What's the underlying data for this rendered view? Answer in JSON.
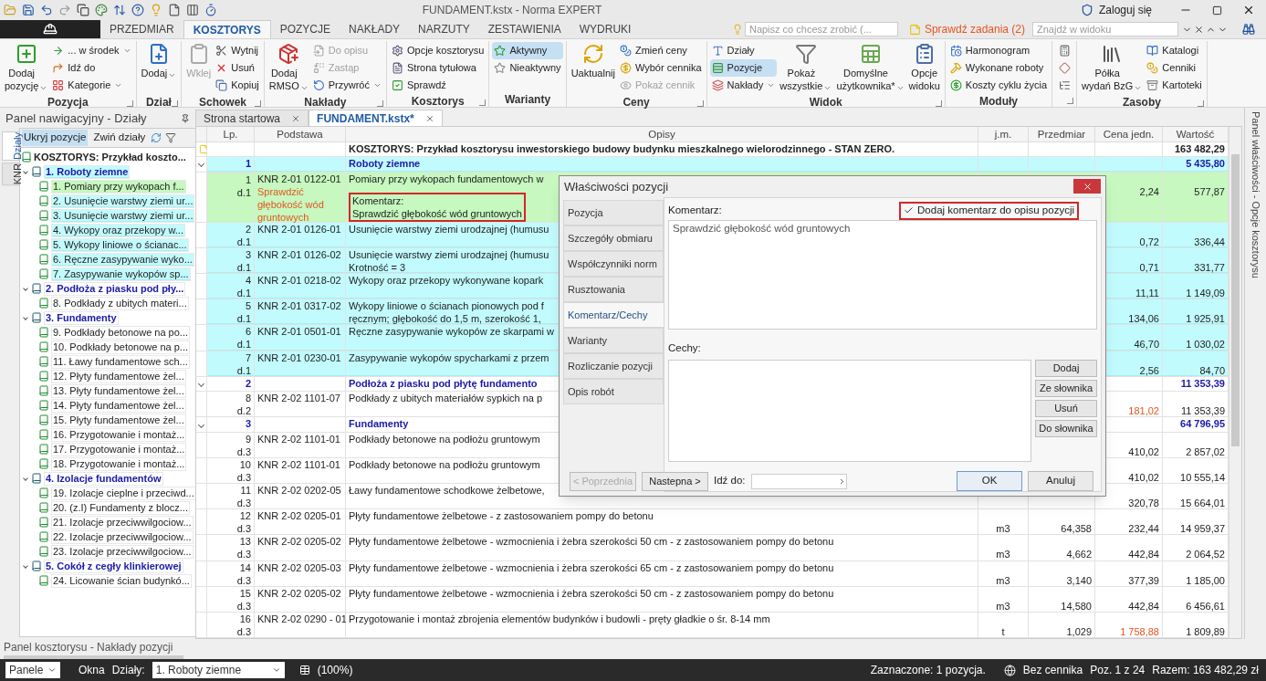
{
  "title_bar": {
    "title": "FUNDAMENT.kstx - Norma EXPERT",
    "login": "Zaloguj się"
  },
  "menu_tabs": [
    {
      "label": "PRZEDMIAR",
      "selected": false
    },
    {
      "label": "KOSZTORYS",
      "selected": true
    },
    {
      "label": "POZYCJE",
      "selected": false
    },
    {
      "label": "NAKŁADY",
      "selected": false
    },
    {
      "label": "NARZUTY",
      "selected": false
    },
    {
      "label": "ZESTAWIENIA",
      "selected": false
    },
    {
      "label": "WYDRUKI",
      "selected": false
    }
  ],
  "tell_me": {
    "placeholder": "Napisz co chcesz zrobić (..."
  },
  "tasks_link": "Sprawdź zadania (2)",
  "find": {
    "placeholder": "Znajdź w widoku"
  },
  "ribbon": [
    {
      "label": "Pozycja",
      "launcher": true,
      "items": [
        {
          "kind": "large",
          "label": "Dodaj\npozycję",
          "dropdown": true,
          "disabled": false,
          "selected": false
        },
        {
          "kind": "small",
          "label": "... w środek",
          "dropdown": true,
          "disabled": false,
          "selected": false
        },
        {
          "kind": "small",
          "label": "Idź do",
          "dropdown": false,
          "disabled": false,
          "selected": false
        },
        {
          "kind": "small",
          "label": "Kategorie",
          "dropdown": true,
          "disabled": false,
          "selected": false
        }
      ]
    },
    {
      "label": "Dział",
      "launcher": true,
      "items": [
        {
          "kind": "large",
          "label": "Dodaj",
          "dropdown": true,
          "disabled": false,
          "selected": false
        }
      ]
    },
    {
      "label": "Schowek",
      "launcher": true,
      "items": [
        {
          "kind": "large",
          "label": "Wklej",
          "dropdown": false,
          "disabled": true,
          "selected": false
        },
        {
          "kind": "small",
          "label": "Wytnij",
          "dropdown": false,
          "disabled": false,
          "selected": false
        },
        {
          "kind": "small",
          "label": "Usuń",
          "dropdown": false,
          "disabled": false,
          "selected": false
        },
        {
          "kind": "small",
          "label": "Kopiuj",
          "dropdown": false,
          "disabled": false,
          "selected": false
        }
      ]
    },
    {
      "label": "Nakłady",
      "launcher": true,
      "items": [
        {
          "kind": "large",
          "label": "Dodaj\nRMSO",
          "dropdown": true,
          "disabled": false,
          "selected": false
        },
        {
          "kind": "small",
          "label": "Do opisu",
          "dropdown": false,
          "disabled": true,
          "selected": false
        },
        {
          "kind": "small",
          "label": "Zastąp",
          "dropdown": false,
          "disabled": true,
          "selected": false
        },
        {
          "kind": "small",
          "label": "Przywróć",
          "dropdown": true,
          "disabled": false,
          "selected": false
        }
      ]
    },
    {
      "label": "Kosztorys",
      "launcher": true,
      "items": [
        {
          "kind": "small",
          "label": "Opcje kosztorysu",
          "dropdown": false,
          "disabled": false,
          "selected": false
        },
        {
          "kind": "small",
          "label": "Strona tytułowa",
          "dropdown": false,
          "disabled": false,
          "selected": false
        },
        {
          "kind": "small",
          "label": "Sprawdź",
          "dropdown": false,
          "disabled": false,
          "selected": false
        }
      ]
    },
    {
      "label": "Warianty",
      "launcher": false,
      "items": [
        {
          "kind": "small",
          "label": "Aktywny",
          "dropdown": false,
          "disabled": false,
          "selected": true
        },
        {
          "kind": "small",
          "label": "Nieaktywny",
          "dropdown": false,
          "disabled": false,
          "selected": false
        }
      ]
    },
    {
      "label": "Ceny",
      "launcher": true,
      "items": [
        {
          "kind": "large",
          "label": "Uaktualnij",
          "dropdown": false,
          "disabled": false,
          "selected": false
        },
        {
          "kind": "small",
          "label": "Zmień ceny",
          "dropdown": false,
          "disabled": false,
          "selected": false
        },
        {
          "kind": "small",
          "label": "Wybór cennika",
          "dropdown": false,
          "disabled": false,
          "selected": false
        },
        {
          "kind": "small",
          "label": "Pokaż cennik",
          "dropdown": false,
          "disabled": true,
          "selected": false
        }
      ]
    },
    {
      "label": "Widok",
      "launcher": true,
      "items": [
        {
          "kind": "small",
          "label": "Działy",
          "dropdown": false,
          "disabled": false,
          "selected": false
        },
        {
          "kind": "small",
          "label": "Pozycje",
          "dropdown": false,
          "disabled": false,
          "selected": true
        },
        {
          "kind": "small",
          "label": "Nakłady",
          "dropdown": true,
          "disabled": false,
          "selected": false
        },
        {
          "kind": "large",
          "label": "Pokaż\nwszystkie",
          "dropdown": true,
          "disabled": false,
          "selected": false
        },
        {
          "kind": "large",
          "label": "Domyślne\nużytkownika*",
          "dropdown": true,
          "disabled": false,
          "selected": false
        },
        {
          "kind": "large",
          "label": "Opcje\nwidoku",
          "dropdown": false,
          "disabled": false,
          "selected": false
        }
      ]
    },
    {
      "label": "Moduły",
      "launcher": false,
      "items": [
        {
          "kind": "small",
          "label": "Harmonogram",
          "dropdown": false,
          "disabled": false,
          "selected": false
        },
        {
          "kind": "small",
          "label": "Wykonane roboty",
          "dropdown": false,
          "disabled": false,
          "selected": false
        },
        {
          "kind": "small",
          "label": "Koszty cyklu życia",
          "dropdown": false,
          "disabled": false,
          "selected": false
        }
      ]
    },
    {
      "launcher": true,
      "items": [
        {
          "kind": "icon",
          "dropdown": false,
          "disabled": false,
          "selected": false
        },
        {
          "kind": "icon",
          "dropdown": false,
          "disabled": false,
          "selected": false
        },
        {
          "kind": "icon",
          "dropdown": false,
          "disabled": false,
          "selected": false
        }
      ]
    },
    {
      "label": "Zasoby",
      "launcher": true,
      "items": [
        {
          "kind": "large",
          "label": "Półka\nwydań BzG",
          "dropdown": true,
          "disabled": false,
          "selected": false
        },
        {
          "kind": "small",
          "label": "Katalogi",
          "dropdown": false,
          "disabled": false,
          "selected": false
        },
        {
          "kind": "small",
          "label": "Cenniki",
          "dropdown": false,
          "disabled": false,
          "selected": false
        },
        {
          "kind": "small",
          "label": "Kartoteki",
          "dropdown": false,
          "disabled": false,
          "selected": false
        }
      ]
    }
  ],
  "navigator": {
    "title": "Panel nawigacyjny - Działy",
    "side_tabs": [
      {
        "label": "Działy",
        "selected": true
      },
      {
        "label": "KNR",
        "selected": false
      }
    ],
    "tools": [
      {
        "label": "Ukryj pozycje",
        "selected": true
      },
      {
        "label": "Zwiń działy",
        "selected": false
      }
    ],
    "tree": {
      "label": "KOSZTORYS: Przykład koszto...",
      "children": [
        {
          "label": "1. Roboty ziemne",
          "expanded": true,
          "selected": false,
          "highlighted": true,
          "children": [
            {
              "label": "1. Pomiary przy wykopach f...",
              "selected": true,
              "highlighted": false
            },
            {
              "label": "2. Usunięcie warstwy ziemi ur...",
              "selected": false,
              "highlighted": true
            },
            {
              "label": "3. Usunięcie warstwy ziemi ur...",
              "selected": false,
              "highlighted": true
            },
            {
              "label": "4. Wykopy oraz przekopy w...",
              "selected": false,
              "highlighted": true
            },
            {
              "label": "5. Wykopy liniowe o ścianac...",
              "selected": false,
              "highlighted": true
            },
            {
              "label": "6. Ręczne zasypywanie wyko...",
              "selected": false,
              "highlighted": true
            },
            {
              "label": "7. Zasypywanie wykopów sp...",
              "selected": false,
              "highlighted": true
            }
          ]
        },
        {
          "label": "2. Podłoża z piasku pod pły...",
          "expanded": true,
          "selected": false,
          "highlighted": false,
          "children": [
            {
              "label": "8. Podkłady z ubitych materi...",
              "selected": false,
              "highlighted": false
            }
          ]
        },
        {
          "label": "3. Fundamenty",
          "expanded": true,
          "selected": false,
          "highlighted": false,
          "children": [
            {
              "label": "9. Podkłady betonowe na po...",
              "selected": false,
              "highlighted": false
            },
            {
              "label": "10. Podkłady betonowe na p...",
              "selected": false,
              "highlighted": false
            },
            {
              "label": "11. Ławy fundamentowe sch...",
              "selected": false,
              "highlighted": false
            },
            {
              "label": "12. Płyty fundamentowe żel...",
              "selected": false,
              "highlighted": false
            },
            {
              "label": "13. Płyty fundamentowe żel...",
              "selected": false,
              "highlighted": false
            },
            {
              "label": "14. Płyty fundamentowe żel...",
              "selected": false,
              "highlighted": false
            },
            {
              "label": "15. Płyty fundamentowe żel...",
              "selected": false,
              "highlighted": false
            },
            {
              "label": "16. Przygotowanie i montaż...",
              "selected": false,
              "highlighted": false
            },
            {
              "label": "17. Przygotowanie i montaż...",
              "selected": false,
              "highlighted": false
            },
            {
              "label": "18. Przygotowanie i montaż...",
              "selected": false,
              "highlighted": false
            }
          ]
        },
        {
          "label": "4. Izolacje fundamentów",
          "expanded": true,
          "selected": false,
          "highlighted": false,
          "children": [
            {
              "label": "19. Izolacje cieplne i przeciwd...",
              "selected": false,
              "highlighted": false
            },
            {
              "label": "20. (z.I) Fundamenty z blocz...",
              "selected": false,
              "highlighted": false
            },
            {
              "label": "21. Izolacje przeciwwilgociow...",
              "selected": false,
              "highlighted": false
            },
            {
              "label": "22. Izolacje przeciwwilgociow...",
              "selected": false,
              "highlighted": false
            },
            {
              "label": "23. Izolacje przeciwwilgociow...",
              "selected": false,
              "highlighted": false
            }
          ]
        },
        {
          "label": "5. Cokół z cegły klinkierowej",
          "expanded": true,
          "selected": false,
          "highlighted": false,
          "children": [
            {
              "label": "24. Licowanie ścian budynkó...",
              "selected": false,
              "highlighted": false
            }
          ]
        }
      ]
    }
  },
  "doc_tabs": [
    {
      "label": "Strona startowa",
      "selected": false
    },
    {
      "label": "FUNDAMENT.kstx*",
      "selected": true
    }
  ],
  "table": {
    "columns": [
      "Lp.",
      "Podstawa",
      "Opisy",
      "j.m.",
      "Przedmiar",
      "Cena jedn.",
      "Wartość"
    ],
    "rows": [
      {
        "kind": "root",
        "description": "KOSZTORYS: Przykład kosztorysu inwestorskiego budowy budynku mieszkalnego wielorodzinnego  - STAN ZERO.",
        "value": "163 482,29",
        "selected": false,
        "highlighted": false
      },
      {
        "kind": "section",
        "number": "1",
        "description": "Roboty ziemne",
        "value": "5 435,80",
        "selected": false,
        "highlighted": true
      },
      {
        "kind": "item",
        "number": "1",
        "section": "d.1",
        "basis": "KNR 2-01 0122-01",
        "basis_note": "Sprawdzić głębokość wód gruntowych",
        "description": [
          "Pomiary przy wykopach fundamentowych w"
        ],
        "comment": [
          "Komentarz:",
          "Sprawdzić głębokość wód gruntowych"
        ],
        "unit_price": "2,24",
        "value": "577,87",
        "price_changed": false,
        "selected": true,
        "highlighted": false
      },
      {
        "kind": "item",
        "number": "2",
        "section": "d.1",
        "basis": "KNR 2-01 0126-01",
        "description": [
          "Usunięcie warstwy ziemi urodzajnej (humusu"
        ],
        "unit_price": "0,72",
        "value": "336,44",
        "price_changed": false,
        "selected": false,
        "highlighted": true
      },
      {
        "kind": "item",
        "number": "3",
        "section": "d.1",
        "basis": "KNR 2-01 0126-02",
        "description": [
          "Usunięcie warstwy ziemi urodzajnej (humusu",
          "Krotność = 3"
        ],
        "unit_price": "0,71",
        "value": "331,77",
        "price_changed": false,
        "selected": false,
        "highlighted": true
      },
      {
        "kind": "item",
        "number": "4",
        "section": "d.1",
        "basis": "KNR 2-01 0218-02",
        "description": [
          "Wykopy oraz przekopy wykonywane kopark"
        ],
        "unit_price": "11,11",
        "value": "1 149,09",
        "price_changed": false,
        "selected": false,
        "highlighted": true
      },
      {
        "kind": "item",
        "number": "5",
        "section": "d.1",
        "basis": "KNR 2-01 0317-02",
        "description": [
          "Wykopy liniowe o ścianach pionowych pod f",
          "ręcznym; głębokość do 1,5 m, szerokość 1,"
        ],
        "unit_price": "134,06",
        "value": "1 925,91",
        "price_changed": false,
        "selected": false,
        "highlighted": true
      },
      {
        "kind": "item",
        "number": "6",
        "section": "d.1",
        "basis": "KNR 2-01 0501-01",
        "description": [
          "Ręczne zasypywanie wykopów ze skarpami w"
        ],
        "unit_price": "46,70",
        "value": "1 030,02",
        "price_changed": false,
        "selected": false,
        "highlighted": true
      },
      {
        "kind": "item",
        "number": "7",
        "section": "d.1",
        "basis": "KNR 2-01 0230-01",
        "description": [
          "Zasypywanie wykopów spycharkami z przem"
        ],
        "unit_price": "2,56",
        "value": "84,70",
        "price_changed": false,
        "selected": false,
        "highlighted": true
      },
      {
        "kind": "section",
        "number": "2",
        "description": "Podłoża z piasku pod płytę fundamento",
        "value": "11 353,39",
        "selected": false,
        "highlighted": false
      },
      {
        "kind": "item",
        "number": "8",
        "section": "d.2",
        "basis": "KNR 2-02 1101-07",
        "description": [
          "Podkłady z ubitych materiałów sypkich na p"
        ],
        "unit_price": "181,02",
        "value": "11 353,39",
        "price_changed": true,
        "selected": false,
        "highlighted": false
      },
      {
        "kind": "section",
        "number": "3",
        "description": "Fundamenty",
        "value": "64 796,95",
        "selected": false,
        "highlighted": false
      },
      {
        "kind": "item",
        "number": "9",
        "section": "d.3",
        "basis": "KNR 2-02 1101-01",
        "description": [
          "Podkłady betonowe na podłożu gruntowym"
        ],
        "unit_price": "410,02",
        "value": "2 857,02",
        "price_changed": false,
        "selected": false,
        "highlighted": false
      },
      {
        "kind": "item",
        "number": "10",
        "section": "d.3",
        "basis": "KNR 2-02 1101-01",
        "description": [
          "Podkłady betonowe na podłożu gruntowym"
        ],
        "unit_price": "410,02",
        "value": "10 555,14",
        "price_changed": false,
        "selected": false,
        "highlighted": false
      },
      {
        "kind": "item",
        "number": "11",
        "section": "d.3",
        "basis": "KNR 2-02 0202-05",
        "description": [
          "Ławy fundamentowe schodkowe żelbetowe,"
        ],
        "unit_price": "320,78",
        "value": "15 664,01",
        "price_changed": false,
        "selected": false,
        "highlighted": false
      },
      {
        "kind": "item",
        "number": "12",
        "section": "d.3",
        "basis": "KNR 2-02 0205-01",
        "description": [
          "Płyty fundamentowe żelbetowe - z zastosowaniem pompy do betonu"
        ],
        "unit": "m3",
        "quantity": "64,358",
        "unit_price": "232,44",
        "value": "14 959,37",
        "price_changed": false,
        "selected": false,
        "highlighted": false
      },
      {
        "kind": "item",
        "number": "13",
        "section": "d.3",
        "basis": "KNR 2-02 0205-02",
        "description": [
          "Płyty fundamentowe żelbetowe - wzmocnienia i żebra szerokości 50 cm - z zastosowaniem pompy do betonu"
        ],
        "unit": "m3",
        "quantity": "4,662",
        "unit_price": "442,84",
        "value": "2 064,52",
        "price_changed": false,
        "selected": false,
        "highlighted": false
      },
      {
        "kind": "item",
        "number": "14",
        "section": "d.3",
        "basis": "KNR 2-02 0205-03",
        "description": [
          "Płyty fundamentowe żelbetowe - wzmocnienia i żebra szerokości 65 cm - z zastosowaniem pompy do betonu"
        ],
        "unit": "m3",
        "quantity": "3,140",
        "unit_price": "377,39",
        "value": "1 185,00",
        "price_changed": false,
        "selected": false,
        "highlighted": false
      },
      {
        "kind": "item",
        "number": "15",
        "section": "d.3",
        "basis": "KNR 2-02 0205-02",
        "description": [
          "Płyty fundamentowe żelbetowe - wzmocnienia i żebra szerokości 50 cm - z zastosowaniem pompy do betonu"
        ],
        "unit": "m3",
        "quantity": "14,580",
        "unit_price": "442,84",
        "value": "6 456,61",
        "price_changed": false,
        "selected": false,
        "highlighted": false
      },
      {
        "kind": "item",
        "number": "16",
        "section": "d.3",
        "basis": "KNR 2-02 0290 - 01",
        "description": [
          "Przygotowanie i montaż zbrojenia elementów budynków i budowli - pręty gładkie o śr. 8-14 mm"
        ],
        "unit": "t",
        "quantity": "1,029",
        "unit_price": "1 758,88",
        "value": "1 809,89",
        "price_changed": true,
        "selected": false,
        "highlighted": false
      }
    ]
  },
  "right_panel": "Panel właściwości - Opcje kosztorysu",
  "dialog": {
    "title": "Właściwości pozycji",
    "tabs": [
      {
        "label": "Pozycja",
        "selected": false
      },
      {
        "label": "Szczegóły obmiaru",
        "selected": false
      },
      {
        "label": "Współczynniki norm",
        "selected": false
      },
      {
        "label": "Rusztowania",
        "selected": false
      },
      {
        "label": "Komentarz/Cechy",
        "selected": true
      },
      {
        "label": "Warianty",
        "selected": false
      },
      {
        "label": "Rozliczanie pozycji",
        "selected": false
      },
      {
        "label": "Opis robót",
        "selected": false
      }
    ],
    "comment_label": "Komentarz:",
    "add_comment": {
      "label": "Dodaj komentarz do opisu pozycji",
      "checked": true
    },
    "comment": "Sprawdzić głębokość wód gruntowych",
    "features_label": "Cechy:",
    "feature_buttons": [
      "Dodaj",
      "Ze słownika",
      "Usuń",
      "Do słownika"
    ],
    "prev": {
      "label": "< Poprzednia",
      "disabled": true
    },
    "next": {
      "label": "Nastepna >",
      "disabled": false
    },
    "goto_label": "Idź do:",
    "ok": "OK",
    "cancel": "Anuluj"
  },
  "bottom_panel": "Panel kosztorysu - Nakłady pozycji",
  "status_bar": {
    "panels": "Panele",
    "windows": "Okna",
    "sections_label": "Działy:",
    "section_value": "1. Roboty ziemne",
    "zoom": "(100%)",
    "selection": "Zaznaczone: 1 pozycja.",
    "price_list": "Bez cennika",
    "position": "Poz. 1 z 24",
    "total": "Razem: 163 482,29 zł"
  }
}
